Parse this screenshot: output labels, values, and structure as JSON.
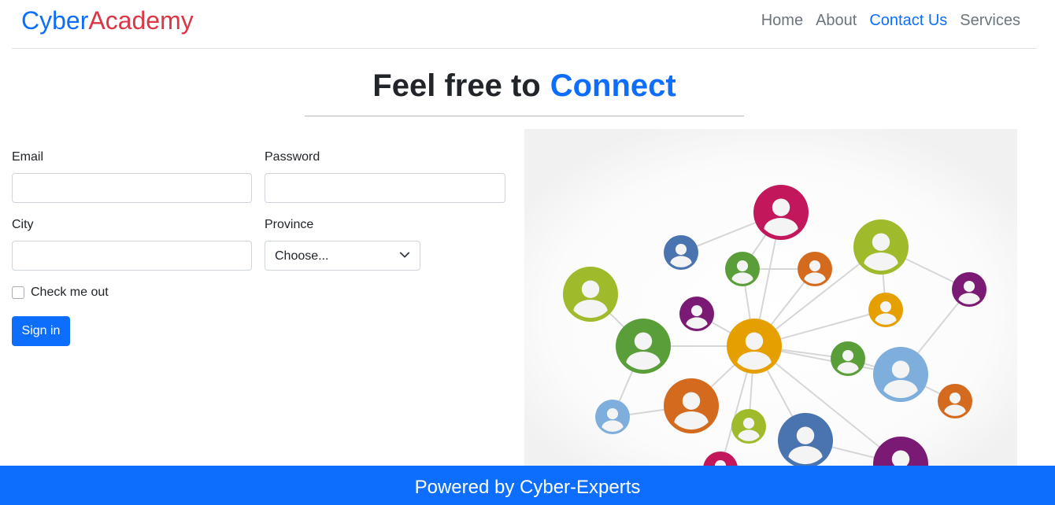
{
  "brand": {
    "part1": "Cyber",
    "part2": "Academy"
  },
  "nav": [
    {
      "label": "Home",
      "active": false
    },
    {
      "label": "About",
      "active": false
    },
    {
      "label": "Contact Us",
      "active": true
    },
    {
      "label": "Services",
      "active": false
    }
  ],
  "hero": {
    "text": "Feel free to",
    "accent": "Connect"
  },
  "form": {
    "email_label": "Email",
    "email_value": "",
    "password_label": "Password",
    "password_value": "",
    "city_label": "City",
    "city_value": "",
    "province_label": "Province",
    "province_selected": "Choose...",
    "check_label": "Check me out",
    "submit_label": "Sign in"
  },
  "illustration": {
    "icon": "people-network-icon"
  },
  "footer": {
    "text": "Powered by Cyber-Experts"
  },
  "colors": {
    "primary": "#0d6efd",
    "brand_red": "#dc3545"
  }
}
